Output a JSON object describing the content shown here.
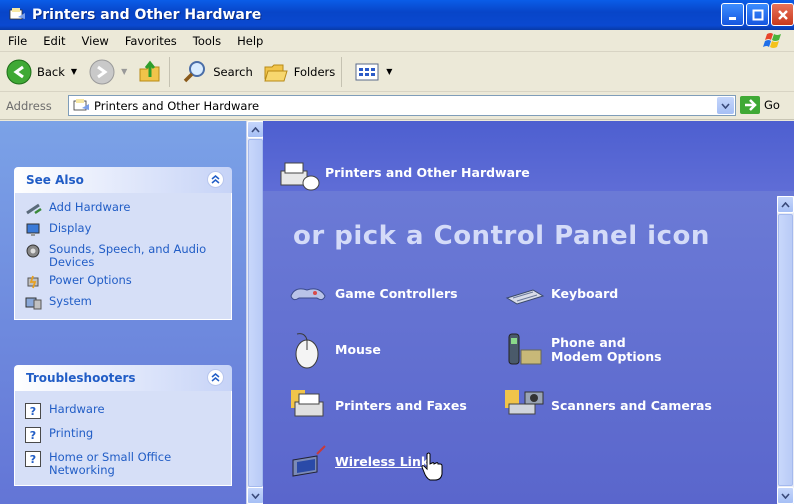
{
  "window": {
    "title": "Printers and Other Hardware"
  },
  "menu": [
    "File",
    "Edit",
    "View",
    "Favorites",
    "Tools",
    "Help"
  ],
  "toolbar": {
    "back": "Back",
    "search": "Search",
    "folders": "Folders"
  },
  "address": {
    "label": "Address",
    "value": "Printers and Other Hardware",
    "go": "Go"
  },
  "see_also": {
    "title": "See Also",
    "items": [
      {
        "label": "Add Hardware",
        "icon": "add-hardware-icon"
      },
      {
        "label": "Display",
        "icon": "display-icon"
      },
      {
        "label": "Sounds, Speech, and Audio Devices",
        "icon": "sound-icon"
      },
      {
        "label": "Power Options",
        "icon": "power-icon"
      },
      {
        "label": "System",
        "icon": "system-icon"
      }
    ]
  },
  "troubleshooters": {
    "title": "Troubleshooters",
    "items": [
      {
        "label": "Hardware"
      },
      {
        "label": "Printing"
      },
      {
        "label": "Home or Small Office Networking"
      }
    ]
  },
  "main": {
    "header": "Printers and Other Hardware",
    "pick": "or pick a Control Panel icon",
    "icons": [
      {
        "label": "Game Controllers",
        "icon": "game-controller-icon"
      },
      {
        "label": "Keyboard",
        "icon": "keyboard-icon"
      },
      {
        "label": "Mouse",
        "icon": "mouse-icon"
      },
      {
        "label": "Phone and Modem Options",
        "icon": "phone-modem-icon"
      },
      {
        "label": "Printers and Faxes",
        "icon": "printer-icon"
      },
      {
        "label": "Scanners and Cameras",
        "icon": "scanner-camera-icon"
      },
      {
        "label": "Wireless Link",
        "icon": "wireless-link-icon"
      }
    ]
  }
}
